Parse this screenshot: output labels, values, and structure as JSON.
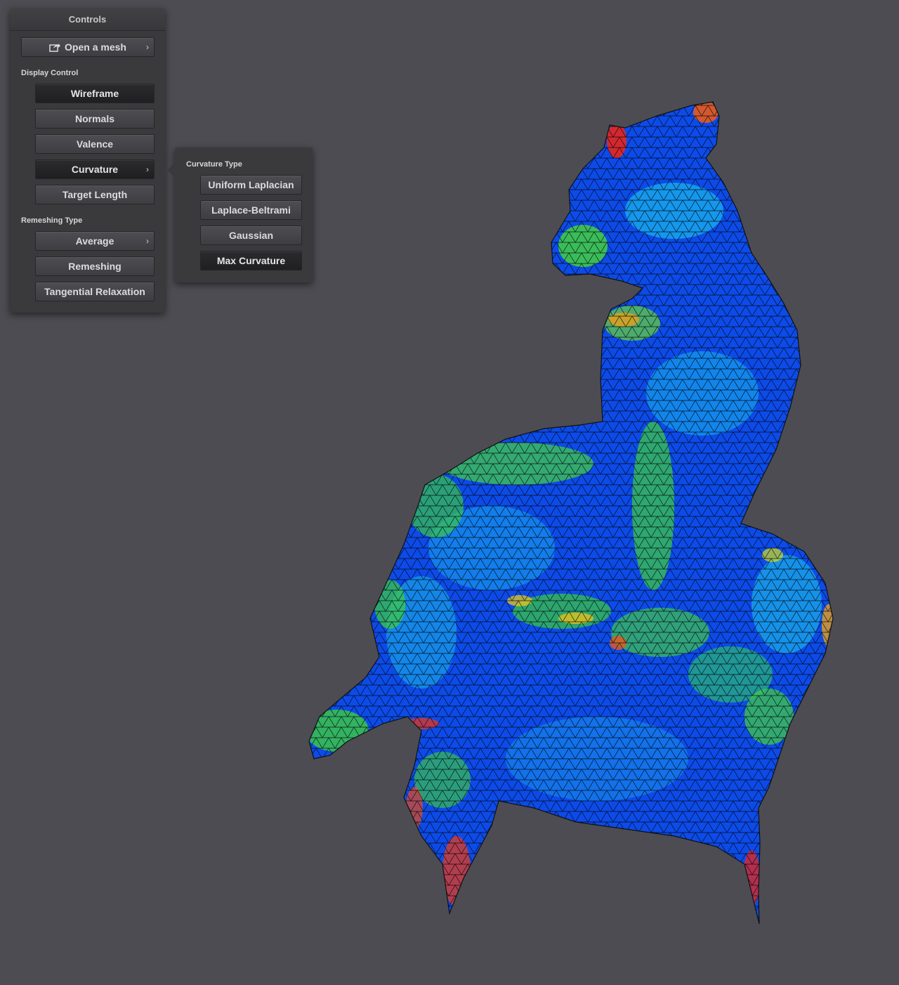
{
  "panel": {
    "title": "Controls",
    "open_mesh_label": "Open a mesh",
    "display_control_label": "Display Control",
    "display_buttons": [
      "Wireframe",
      "Normals",
      "Valence",
      "Curvature",
      "Target Length"
    ],
    "remeshing_type_label": "Remeshing Type",
    "remeshing_type_value": "Average",
    "remeshing_buttons": [
      "Remeshing",
      "Tangential Relaxation"
    ]
  },
  "curvature_popup": {
    "title": "Curvature Type",
    "options": [
      "Uniform Laplacian",
      "Laplace-Beltrami",
      "Gaussian",
      "Max Curvature"
    ]
  },
  "icons": {
    "open": "share-open-icon",
    "chevron": "chevron-right-icon"
  },
  "colors": {
    "background": "#4d4c52",
    "panel": "#3a3a3d",
    "mesh_low": "#0b3fe6",
    "mesh_mid": "#19d0e8",
    "mesh_high_green": "#3bd23b",
    "mesh_peak": "#e8261c"
  }
}
